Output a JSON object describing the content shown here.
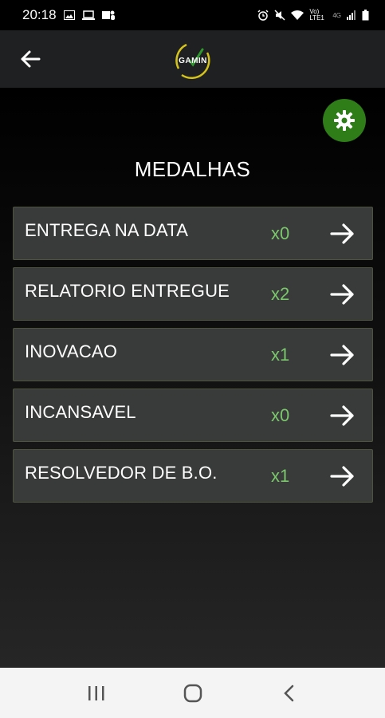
{
  "status_bar": {
    "time": "20:18",
    "carrier_text": "Vo) LTE1",
    "network": "4G"
  },
  "app_bar": {
    "logo_text": "GAMIN"
  },
  "page": {
    "title": "MEDALHAS"
  },
  "medals": [
    {
      "name": "ENTREGA NA DATA",
      "count": "x0"
    },
    {
      "name": "RELATORIO ENTREGUE",
      "count": "x2"
    },
    {
      "name": "INOVACAO",
      "count": "x1"
    },
    {
      "name": "INCANSAVEL",
      "count": "x0"
    },
    {
      "name": "RESOLVEDOR DE B.O.",
      "count": "x1"
    }
  ],
  "colors": {
    "accent_green": "#2e7d18",
    "count_green": "#7bc86c",
    "logo_yellow": "#d4c21c"
  }
}
